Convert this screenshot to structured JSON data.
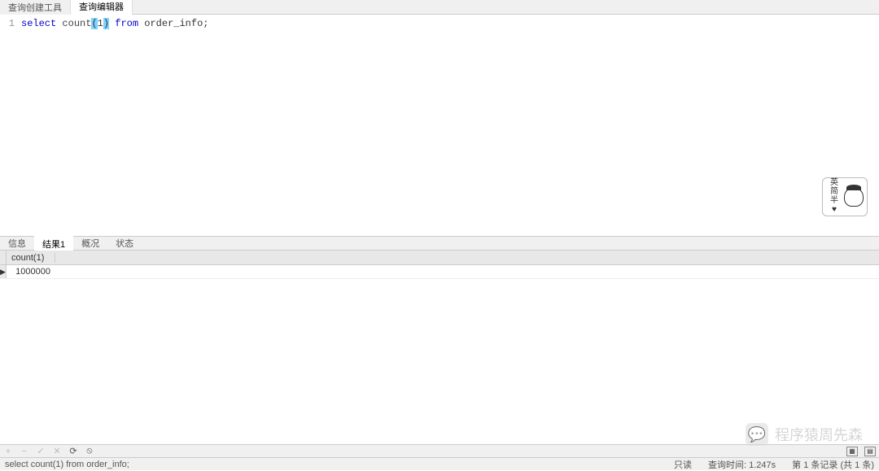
{
  "top_tabs": {
    "builder": "查询创建工具",
    "editor": "查询编辑器"
  },
  "editor": {
    "line_no": "1",
    "sql": {
      "select": "select",
      "count": "count",
      "lp": "(",
      "star": "1",
      "rp": ")",
      "from": "from",
      "table": "order_info",
      "semi": ";"
    }
  },
  "avatar": {
    "line1": "英",
    "line2": "简",
    "line3": "半",
    "heart": "♥"
  },
  "results_tabs": {
    "info": "信息",
    "result1": "结果1",
    "profile": "概况",
    "status": "状态"
  },
  "grid": {
    "header": "count(1)",
    "row_marker": "▶",
    "value": "1000000"
  },
  "toolbar": {
    "plus": "+",
    "minus": "−",
    "check": "✓",
    "x": "✕",
    "refresh": "⟳",
    "stop": "⦸"
  },
  "status": {
    "query_echo": "select count(1) from order_info;",
    "readonly": "只读",
    "query_time": "查询时间: 1.247s",
    "records": "第 1 条记录 (共 1 条)"
  },
  "watermark": {
    "icon": "💬",
    "text": "程序猿周先森"
  }
}
